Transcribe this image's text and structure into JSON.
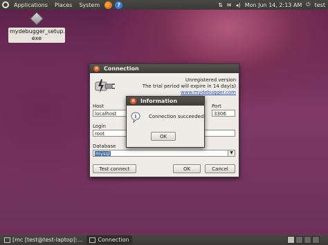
{
  "top_panel": {
    "menus": [
      "Applications",
      "Places",
      "System"
    ],
    "clock": "Mon Jun 14,  2:13 AM",
    "user": "test",
    "icons": [
      "ubuntu-logo",
      "firefox-icon",
      "help-icon",
      "network-icon",
      "mail-icon",
      "volume-icon",
      "power-icon"
    ]
  },
  "desktop": {
    "icon_label": "mydebugger_setup.\nexe"
  },
  "connection_window": {
    "title": "Connection",
    "unregistered": "Unregistered version",
    "trial": "The trial period will expire in 14 day(s)",
    "link": "www.mydebugger.com",
    "host_label": "Host",
    "host_value": "localhost",
    "port_label": "Port",
    "port_value": "3306",
    "login_label": "Login",
    "login_value": "root",
    "database_label": "Database",
    "database_value": "mysql",
    "test_connect": "Test connect",
    "ok": "OK",
    "cancel": "Cancel"
  },
  "info_dialog": {
    "title": "Information",
    "message": "Connection succeeded!",
    "ok": "OK"
  },
  "bottom_panel": {
    "tasks": [
      "[mc [test@test-laptop]:...",
      "Connection"
    ]
  }
}
